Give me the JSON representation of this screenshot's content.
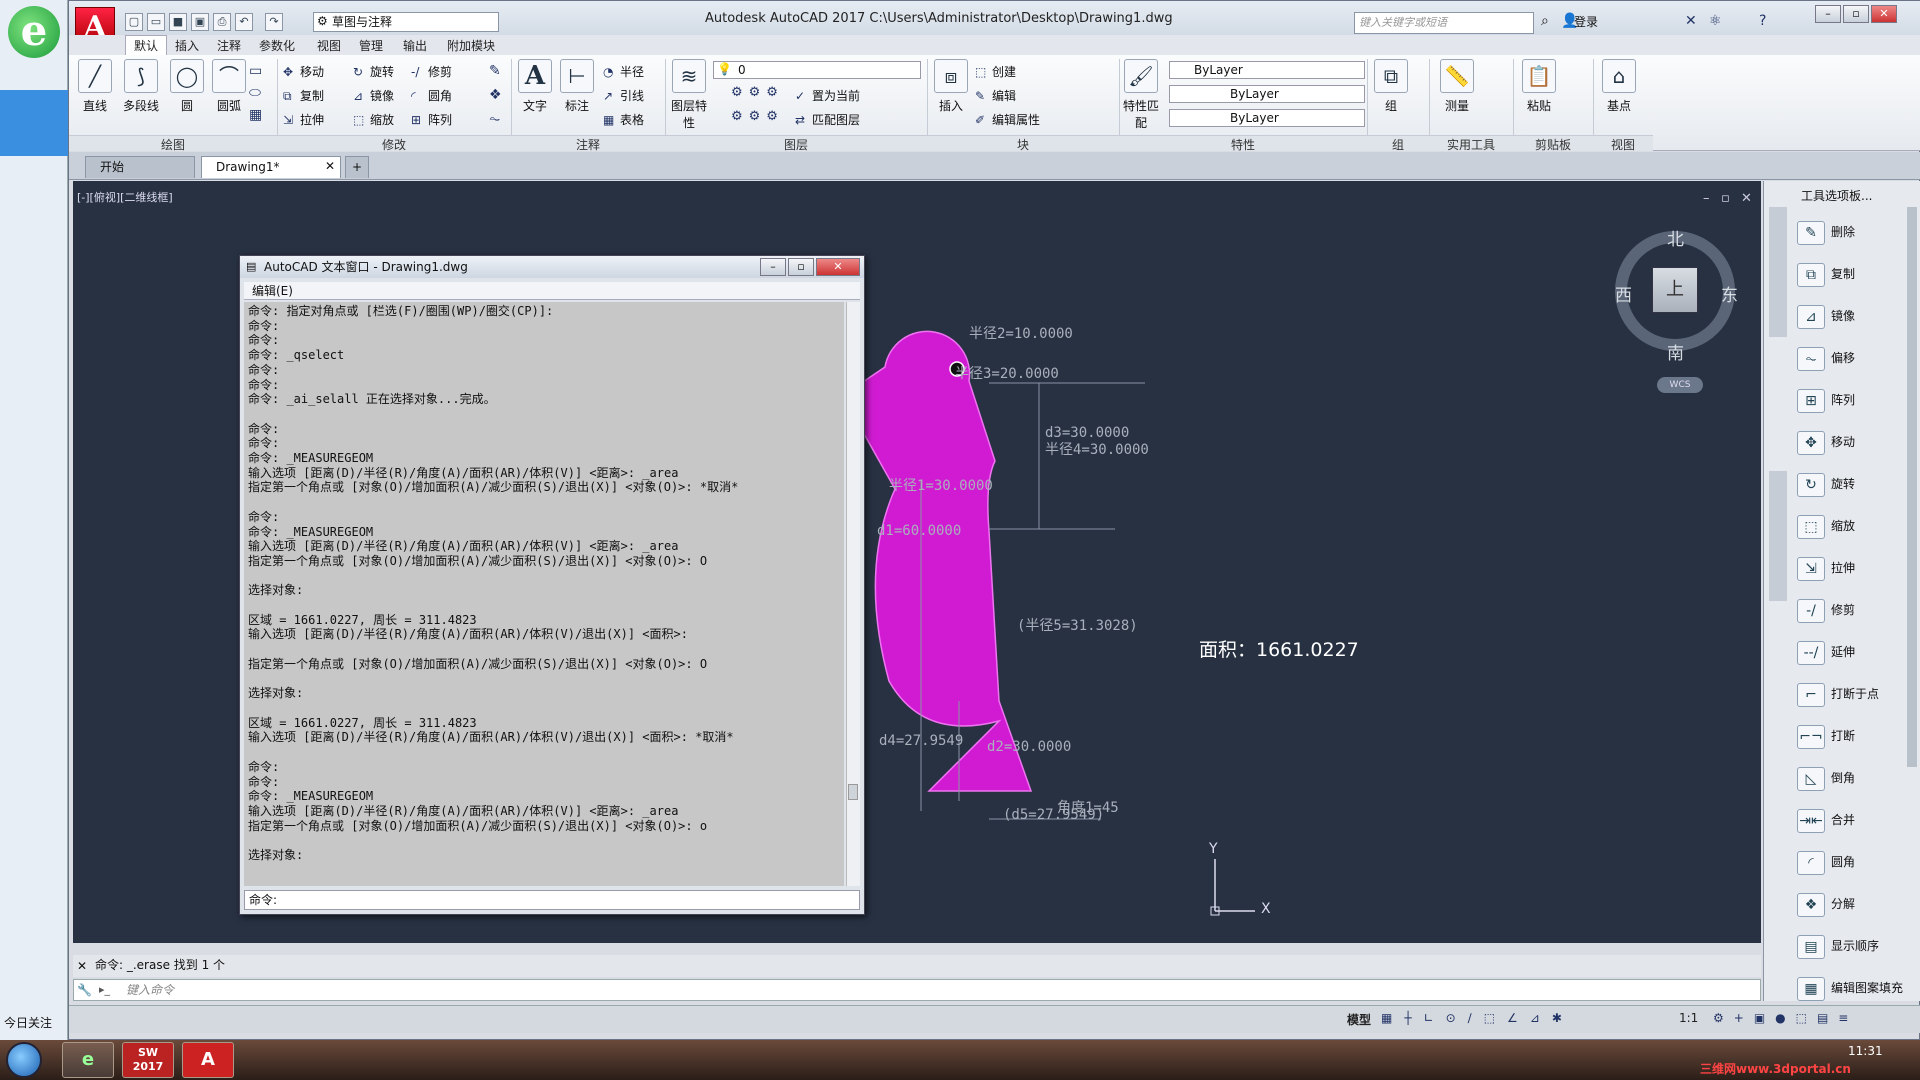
{
  "desktop": {
    "today_label": "今日关注"
  },
  "titlebar": {
    "logo": "A",
    "workspace": "草图与注释",
    "title": "Autodesk AutoCAD 2017    C:\\Users\\Administrator\\Desktop\\Drawing1.dwg",
    "search_placeholder": "键入关键字或短语",
    "login": "登录"
  },
  "ribbon_tabs": [
    "默认",
    "插入",
    "注释",
    "参数化",
    "视图",
    "管理",
    "输出",
    "附加模块"
  ],
  "ribbon": {
    "draw": {
      "label": "绘图",
      "items": [
        "直线",
        "多段线",
        "圆",
        "圆弧"
      ]
    },
    "modify": {
      "label": "修改",
      "items": [
        "移动",
        "旋转",
        "修剪",
        "复制",
        "镜像",
        "圆角",
        "拉伸",
        "缩放",
        "阵列"
      ]
    },
    "annotation": {
      "label": "注释",
      "items": [
        "文字",
        "标注"
      ],
      "small": [
        "半径",
        "引线",
        "表格"
      ]
    },
    "layers": {
      "label": "图层",
      "items": [
        "图层特性"
      ],
      "layer_value": "0",
      "small": [
        "置为当前",
        "匹配图层"
      ]
    },
    "block": {
      "label": "块",
      "items": [
        "插入"
      ],
      "small": [
        "创建",
        "编辑",
        "编辑属性"
      ]
    },
    "properties": {
      "label": "特性",
      "items": [
        "特性匹配"
      ],
      "bylayer1": "ByLayer",
      "bylayer2": "ByLayer",
      "bylayer3": "ByLayer"
    },
    "groups": {
      "label": "组",
      "items": [
        "组"
      ]
    },
    "utilities": {
      "label": "实用工具",
      "items": [
        "测量"
      ]
    },
    "clipboard": {
      "label": "剪贴板",
      "items": [
        "粘贴"
      ]
    },
    "view": {
      "label": "视图",
      "items": [
        "基点"
      ]
    }
  },
  "doc_tabs": {
    "start": "开始",
    "drawing": "Drawing1*",
    "plus": "+"
  },
  "viewport": {
    "label": "[-][俯视][二维线框]",
    "compass": {
      "north": "北",
      "south": "南",
      "east": "东",
      "west": "西",
      "top": "上",
      "wcs": "WCS"
    }
  },
  "drawing": {
    "dims": [
      "半径2=10.0000",
      "半径3=20.0000",
      "半径4=30.0000",
      "d3=30.0000",
      "半径1=30.0000",
      "d1=60.0000",
      "(半径5=31.3028)",
      "d4=27.9549",
      "d2=30.0000",
      "角度1=45",
      "(d5=27.9549)"
    ],
    "area_label": "面积：1661.0227",
    "ucs_x": "X",
    "ucs_y": "Y",
    "fill_color": "#e01adf"
  },
  "text_window": {
    "title": "AutoCAD 文本窗口 - Drawing1.dwg",
    "menu": "编辑(E)",
    "lines": [
      "命令: 指定对角点或 [栏选(F)/圈围(WP)/圈交(CP)]:",
      "命令:",
      "命令:",
      "命令: _qselect",
      "命令:",
      "命令:",
      "命令: _ai_selall 正在选择对象...完成。",
      "",
      "命令:",
      "命令:",
      "命令: _MEASUREGEOM",
      "输入选项 [距离(D)/半径(R)/角度(A)/面积(AR)/体积(V)] <距离>: _area",
      "指定第一个角点或 [对象(O)/增加面积(A)/减少面积(S)/退出(X)] <对象(O)>: *取消*",
      "",
      "命令:",
      "命令: _MEASUREGEOM",
      "输入选项 [距离(D)/半径(R)/角度(A)/面积(AR)/体积(V)] <距离>: _area",
      "指定第一个角点或 [对象(O)/增加面积(A)/减少面积(S)/退出(X)] <对象(O)>: O",
      "",
      "选择对象:",
      "",
      "区域 = 1661.0227, 周长 = 311.4823",
      "输入选项 [距离(D)/半径(R)/角度(A)/面积(AR)/体积(V)/退出(X)] <面积>:",
      "",
      "指定第一个角点或 [对象(O)/增加面积(A)/减少面积(S)/退出(X)] <对象(O)>: O",
      "",
      "选择对象:",
      "",
      "区域 = 1661.0227, 周长 = 311.4823",
      "输入选项 [距离(D)/半径(R)/角度(A)/面积(AR)/体积(V)/退出(X)] <面积>: *取消*",
      "",
      "命令:",
      "命令:",
      "命令: _MEASUREGEOM",
      "输入选项 [距离(D)/半径(R)/角度(A)/面积(AR)/体积(V)] <距离>: _area",
      "指定第一个角点或 [对象(O)/增加面积(A)/减少面积(S)/退出(X)] <对象(O)>: o",
      "",
      "选择对象:"
    ],
    "prompt": "命令:"
  },
  "command_line": {
    "history": "命令: _.erase 找到 1 个",
    "placeholder": "键入命令"
  },
  "status": {
    "model": "模型",
    "scale": "1:1"
  },
  "palette": {
    "title": "工具选项板...",
    "items": [
      "删除",
      "复制",
      "镜像",
      "偏移",
      "阵列",
      "移动",
      "旋转",
      "缩放",
      "拉伸",
      "修剪",
      "延伸",
      "打断于点",
      "打断",
      "倒角",
      "合并",
      "圆角",
      "分解",
      "显示顺序",
      "编辑图案填充"
    ]
  },
  "taskbar": {
    "time": "11:31",
    "watermark": "三维网www.3dportal.cn",
    "sw_label": "SW\n2017"
  }
}
